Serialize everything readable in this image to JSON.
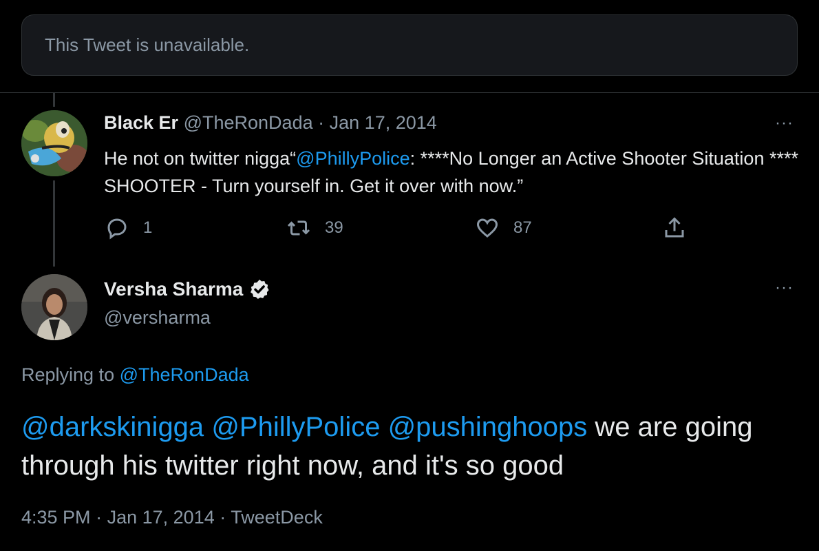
{
  "unavailable_notice": "This Tweet is unavailable.",
  "tweet1": {
    "author_name": "Black Er",
    "author_handle": "@TheRonDada",
    "separator": "·",
    "date": "Jan 17, 2014",
    "more_label": "···",
    "text_part1": "He not on twitter nigga“",
    "mention": "@PhillyPolice",
    "text_part2": ": ****No Longer an Active Shooter Situation **** SHOOTER - Turn yourself in. Get it over with now.”",
    "reply_count": "1",
    "retweet_count": "39",
    "like_count": "87",
    "icons": {
      "reply": "reply-icon",
      "retweet": "retweet-icon",
      "like": "heart-icon",
      "share": "share-icon",
      "more": "more-icon"
    }
  },
  "tweet2": {
    "author_name": "Versha Sharma",
    "author_handle": "@versharma",
    "verified": true,
    "more_label": "···",
    "replying_prefix": "Replying to",
    "replying_to": "@TheRonDada",
    "mentions": [
      "@darkskinigga",
      "@PhillyPolice",
      "@pushinghoops"
    ],
    "text": "we are going through his twitter right now, and it's so good",
    "time": "4:35 PM",
    "separator": "·",
    "date": "Jan 17, 2014",
    "source": "TweetDeck"
  },
  "colors": {
    "background": "#000000",
    "link": "#1d9bf0",
    "muted": "#8b98a5",
    "text": "#e7e9ea",
    "border": "#2f3336"
  }
}
